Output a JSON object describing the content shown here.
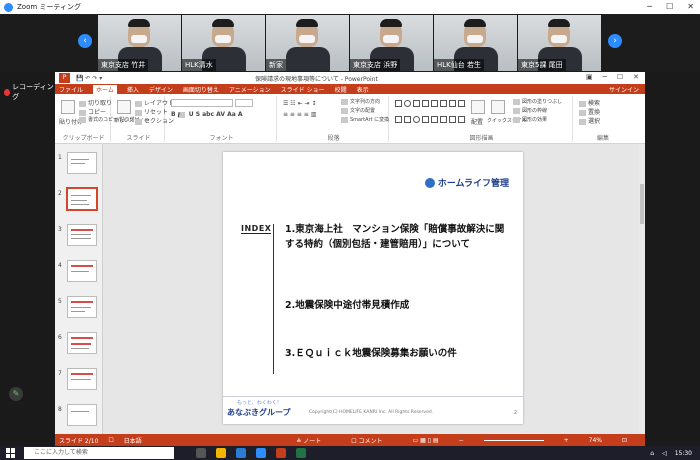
{
  "zoom": {
    "window_title": "Zoom ミーティング",
    "recording_label": "レコーディング",
    "participants": [
      {
        "name": "東京支店 竹井"
      },
      {
        "name": "HLK清水"
      },
      {
        "name": "新家"
      },
      {
        "name": "東京支店 浜野"
      },
      {
        "name": "HLK仙台 若生"
      },
      {
        "name": "東京5課 尾田"
      }
    ]
  },
  "powerpoint": {
    "app_badge": "P",
    "window_title": "保険請求の現地事項等について - PowerPoint",
    "tabs": [
      "ファイル",
      "ホーム",
      "挿入",
      "デザイン",
      "画面切り替え",
      "アニメーション",
      "スライド ショー",
      "校閲",
      "表示"
    ],
    "active_tab": "ホーム",
    "signin": "サインイン",
    "ribbon": {
      "clipboard": {
        "paste": "貼り付け",
        "cut": "切り取り",
        "copy": "コピー",
        "format_painter": "書式のコピー/貼り付け",
        "label": "クリップボード"
      },
      "slides": {
        "new_slide": "新しいスライド",
        "layout": "レイアウト",
        "reset": "リセット",
        "section": "セクション",
        "label": "スライド"
      },
      "font_label": "フォント",
      "paragraph": {
        "text_direction": "文字列の方向",
        "align_text": "文字の配置",
        "smartart": "SmartArt に変換",
        "label": "段落"
      },
      "drawing": {
        "arrange": "配置",
        "quick_styles": "クイックスタイル",
        "shape_fill": "図形の塗りつぶし",
        "shape_outline": "図形の枠線",
        "shape_effects": "図形の効果",
        "label": "図形描画"
      },
      "editing": {
        "find": "検索",
        "replace": "置換",
        "select": "選択",
        "label": "編集"
      }
    },
    "thumbnails": [
      "1",
      "2",
      "3",
      "4",
      "5",
      "6",
      "7",
      "8"
    ],
    "selected_slide": 2,
    "slide": {
      "brand": "ホームライフ管理",
      "index_label": "INDEX",
      "items": [
        "1.東京海上社　マンション保険「賠償事故解決に関する特約（個別包括・建管賠用）」について",
        "2.地震保険中途付帯見積作成",
        "3.ＥＱｕｉｃｋ地震保険募集お願いの件"
      ],
      "footer_slogan": "もっと、わくわく！",
      "footer_logo": "あなぶきグループ",
      "footer_copy": "Copyright(C) HOMELIFE KANRI Inc. All Rights Reserved.",
      "footer_page": "2"
    },
    "status": {
      "slide_pos": "スライド 2/10",
      "language": "日本語",
      "notes": "ノート",
      "comments": "コメント",
      "zoom": "74%"
    }
  },
  "taskbar": {
    "search_placeholder": "ここに入力して検索",
    "time": "15:30"
  }
}
